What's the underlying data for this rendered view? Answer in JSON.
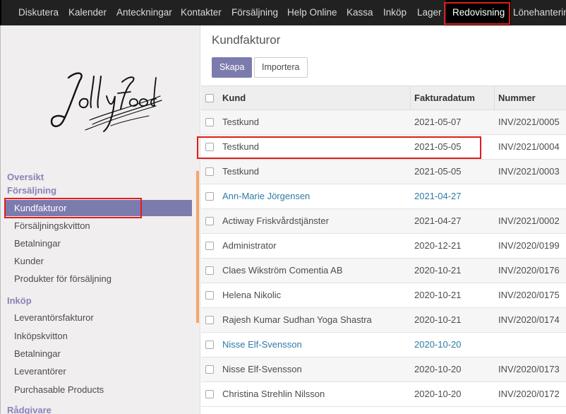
{
  "navbar": {
    "items": [
      {
        "label": "Diskutera"
      },
      {
        "label": "Kalender"
      },
      {
        "label": "Anteckningar"
      },
      {
        "label": "Kontakter"
      },
      {
        "label": "Försäljning"
      },
      {
        "label": "Help Online"
      },
      {
        "label": "Kassa"
      },
      {
        "label": "Inköp"
      },
      {
        "label": "Lager"
      },
      {
        "label": "Redovisning",
        "active": true
      },
      {
        "label": "Lönehantering"
      }
    ]
  },
  "sidebar": {
    "logo_text": "Jolly food",
    "sections": [
      {
        "heading": "Oversikt"
      },
      {
        "heading": "Försäljning",
        "items": [
          "Kundfakturor",
          "Försäljningskvitton",
          "Betalningar",
          "Kunder",
          "Produkter för försäljning"
        ]
      },
      {
        "heading": "Inköp",
        "items": [
          "Leverantörsfakturor",
          "Inköpskvitton",
          "Betalningar",
          "Leverantörer",
          "Purchasable Products"
        ]
      },
      {
        "heading": "Rådgivare"
      }
    ],
    "active_item": "Kundfakturor"
  },
  "main": {
    "title": "Kundfakturor",
    "create_label": "Skapa",
    "import_label": "Importera",
    "columns": [
      "Kund",
      "Fakturadatum",
      "Nummer"
    ],
    "rows": [
      {
        "kund": "Testkund",
        "date": "2021-05-07",
        "num": "INV/2021/0005",
        "draft": false
      },
      {
        "kund": "Testkund",
        "date": "2021-05-05",
        "num": "INV/2021/0004",
        "draft": false
      },
      {
        "kund": "Testkund",
        "date": "2021-05-05",
        "num": "INV/2021/0003",
        "draft": false
      },
      {
        "kund": "Ann-Marie Jörgensen",
        "date": "2021-04-27",
        "num": "",
        "draft": true
      },
      {
        "kund": "Actiway Friskvårdstjänster",
        "date": "2021-04-27",
        "num": "INV/2021/0002",
        "draft": false
      },
      {
        "kund": "Administrator",
        "date": "2020-12-21",
        "num": "INV/2020/0199",
        "draft": false
      },
      {
        "kund": "Claes Wikström Comentia AB",
        "date": "2020-10-21",
        "num": "INV/2020/0176",
        "draft": false
      },
      {
        "kund": "Helena Nikolic",
        "date": "2020-10-21",
        "num": "INV/2020/0175",
        "draft": false
      },
      {
        "kund": "Rajesh Kumar Sudhan Yoga Shastra",
        "date": "2020-10-21",
        "num": "INV/2020/0174",
        "draft": false
      },
      {
        "kund": "Nisse Elf-Svensson",
        "date": "2020-10-20",
        "num": "",
        "draft": true
      },
      {
        "kund": "Nisse Elf-Svensson",
        "date": "2020-10-20",
        "num": "INV/2020/0173",
        "draft": false
      },
      {
        "kund": "Christina Strehlin Nilsson",
        "date": "2020-10-20",
        "num": "INV/2020/0172",
        "draft": false
      }
    ]
  },
  "colors": {
    "accent": "#7c7bad",
    "highlight": "#e21b1b",
    "draft_link": "#2f7aa5",
    "navbar_bg": "#212121"
  }
}
